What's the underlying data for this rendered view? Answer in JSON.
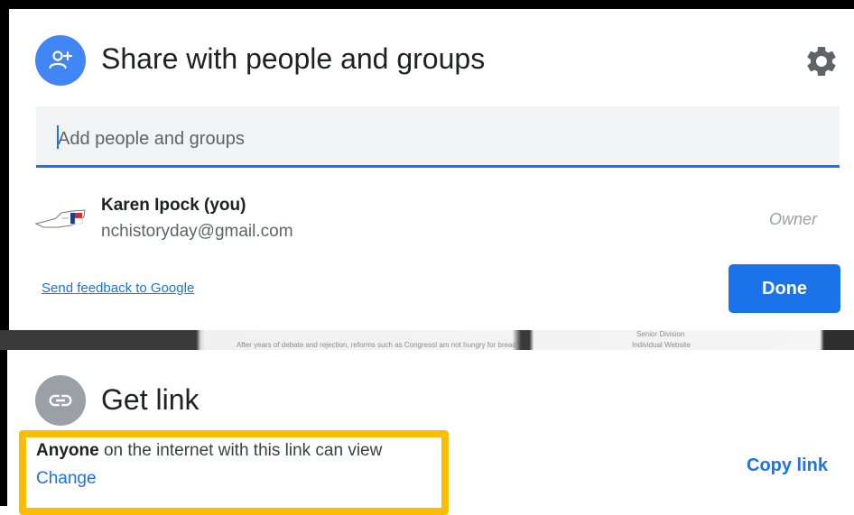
{
  "share": {
    "title": "Share with people and groups",
    "add_placeholder": "Add people and groups",
    "user": {
      "name": "Karen Ipock (you)",
      "email": "nchistoryday@gmail.com",
      "role": "Owner"
    },
    "feedback_link": "Send feedback to Google",
    "done_label": "Done",
    "icons": {
      "header": "person-add-icon",
      "settings": "gear-icon",
      "user_avatar": "nc-state-flag-avatar"
    }
  },
  "background": {
    "fragments": [
      "After years of debate and rejection, reforms such as Congress",
      "I am not hungry for bread",
      "Senior Division",
      "Individual Website"
    ]
  },
  "get_link": {
    "title": "Get link",
    "access_bold": "Anyone",
    "access_rest": " on the internet with this link can view",
    "change_label": "Change",
    "copy_label": "Copy link",
    "icons": {
      "header": "link-icon"
    }
  },
  "colors": {
    "accent": "#1a73e8",
    "share_icon_bg": "#4285f4",
    "link_icon_bg": "#9aa0a6",
    "highlight": "#fbbc04",
    "input_bg": "#f1f3f4"
  }
}
